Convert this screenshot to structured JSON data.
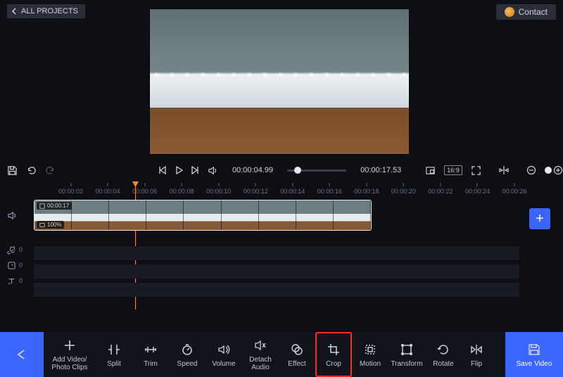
{
  "header": {
    "all_projects": "ALL PROJECTS",
    "contact": "Contact"
  },
  "player": {
    "current_time": "00:00:04.99",
    "total_time": "00:00:17.53",
    "aspect_ratio": "16:9"
  },
  "ruler": {
    "marks": [
      "00:00:02",
      "00:00:04",
      "00:00:06",
      "00:00:08",
      "00:00:10",
      "00:00:12",
      "00:00:14",
      "00:00:16",
      "00:00:18",
      "00:00:20",
      "00:00:22",
      "00:00:24",
      "00:00:26"
    ]
  },
  "clip": {
    "duration_badge": "00:00:17",
    "zoom_badge": "100%"
  },
  "tracks": {
    "audio_count": "0",
    "overlay_count": "0",
    "text_count": "0"
  },
  "toolbar": {
    "add": "Add Video/\nPhoto Clips",
    "split": "Split",
    "trim": "Trim",
    "speed": "Speed",
    "volume": "Volume",
    "detach": "Detach\nAudio",
    "effect": "Effect",
    "crop": "Crop",
    "motion": "Motion",
    "transform": "Transform",
    "rotate": "Rotate",
    "flip": "Flip",
    "save": "Save Video"
  }
}
